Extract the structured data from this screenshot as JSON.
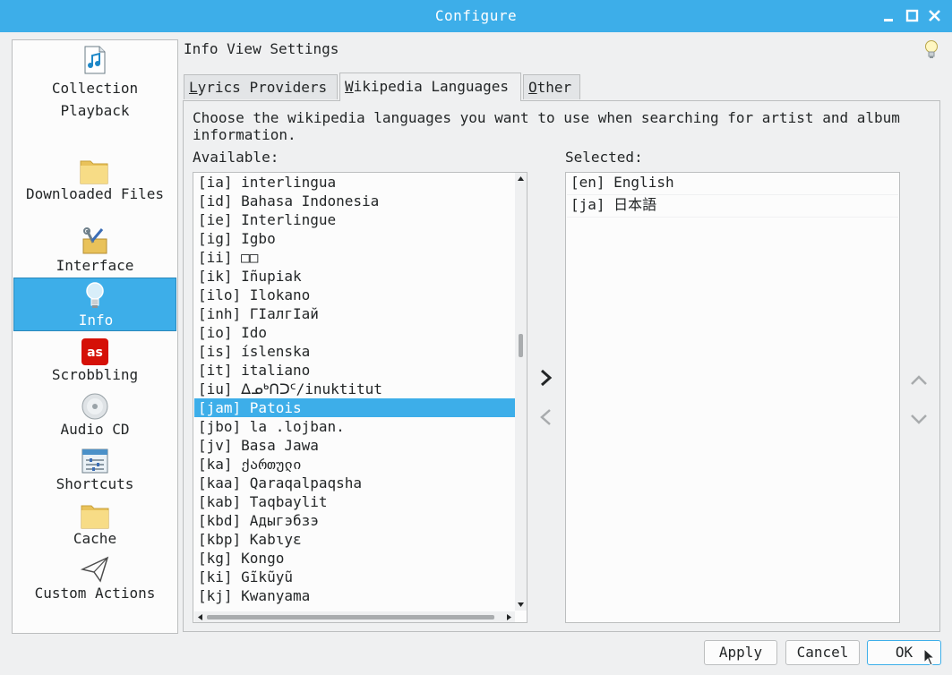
{
  "window": {
    "title": "Configure"
  },
  "sidebar": {
    "items": [
      {
        "label": "Collection",
        "icon": "music-file-icon"
      },
      {
        "label": "Playback",
        "icon": "none"
      },
      {
        "label": "Downloaded Files",
        "icon": "folder-icon"
      },
      {
        "label": "Interface",
        "icon": "tools-icon"
      },
      {
        "label": "Info",
        "icon": "lightbulb-icon"
      },
      {
        "label": "Scrobbling",
        "icon": "lastfm-icon"
      },
      {
        "label": "Audio CD",
        "icon": "cd-icon"
      },
      {
        "label": "Shortcuts",
        "icon": "sliders-icon"
      },
      {
        "label": "Cache",
        "icon": "folder-icon"
      },
      {
        "label": "Custom Actions",
        "icon": "paper-plane-icon"
      }
    ],
    "selected": "Info"
  },
  "header": {
    "title": "Info View Settings"
  },
  "tabs": [
    {
      "label": "Lyrics Providers",
      "accel": "L"
    },
    {
      "label": "Wikipedia Languages",
      "accel": "W"
    },
    {
      "label": "Other",
      "accel": "O"
    }
  ],
  "active_tab": "Wikipedia Languages",
  "content": {
    "description_line1": "Choose the wikipedia languages you want to use when searching for artist and album",
    "description_line2": "information.",
    "available_label": "Available:",
    "selected_label": "Selected:",
    "available": [
      "[ia] interlingua",
      "[id] Bahasa Indonesia",
      "[ie] Interlingue",
      "[ig] Igbo",
      "[ii] □□",
      "[ik] Iñupiak",
      "[ilo] Ilokano",
      "[inh] ГӀалгӀай",
      "[io] Ido",
      "[is] íslenska",
      "[it] italiano",
      "[iu] ᐃᓄᒃᑎᑐᑦ/inuktitut",
      "[jam] Patois",
      "[jbo] la .lojban.",
      "[jv] Basa Jawa",
      "[ka] ქართული",
      "[kaa] Qaraqalpaqsha",
      "[kab] Taqbaylit",
      "[kbd] Адыгэбзэ",
      "[kbp] Kabɩyɛ",
      "[kg] Kongo",
      "[ki] Gĩkũyũ",
      "[kj] Kwanyama"
    ],
    "available_selected": "[jam] Patois",
    "selected": [
      "[en] English",
      "[ja] 日本語"
    ]
  },
  "buttons": {
    "apply": "Apply",
    "cancel": "Cancel",
    "ok": "OK"
  },
  "colors": {
    "accent": "#3daee9",
    "background": "#eff0f1"
  }
}
